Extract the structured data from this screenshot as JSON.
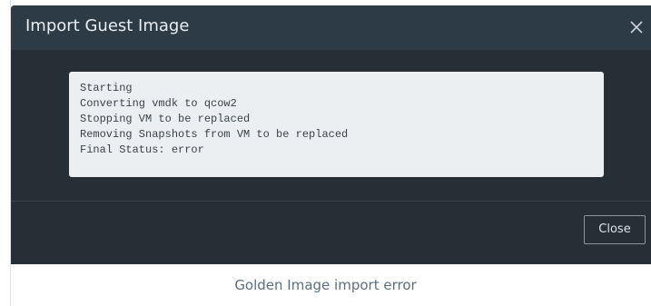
{
  "dialog": {
    "title": "Import Guest Image",
    "close_icon": "close-icon",
    "log_lines": [
      "Starting",
      "Converting vmdk to qcow2",
      "Stopping VM to be replaced",
      "Removing Snapshots from VM to be replaced",
      "Final Status: error"
    ],
    "footer": {
      "close_label": "Close"
    }
  },
  "caption": "Golden Image import error",
  "colors": {
    "header_bg": "#2d3b47",
    "body_bg": "#262e36",
    "log_bg": "#eceff1",
    "caption": "#5a6f7d"
  }
}
